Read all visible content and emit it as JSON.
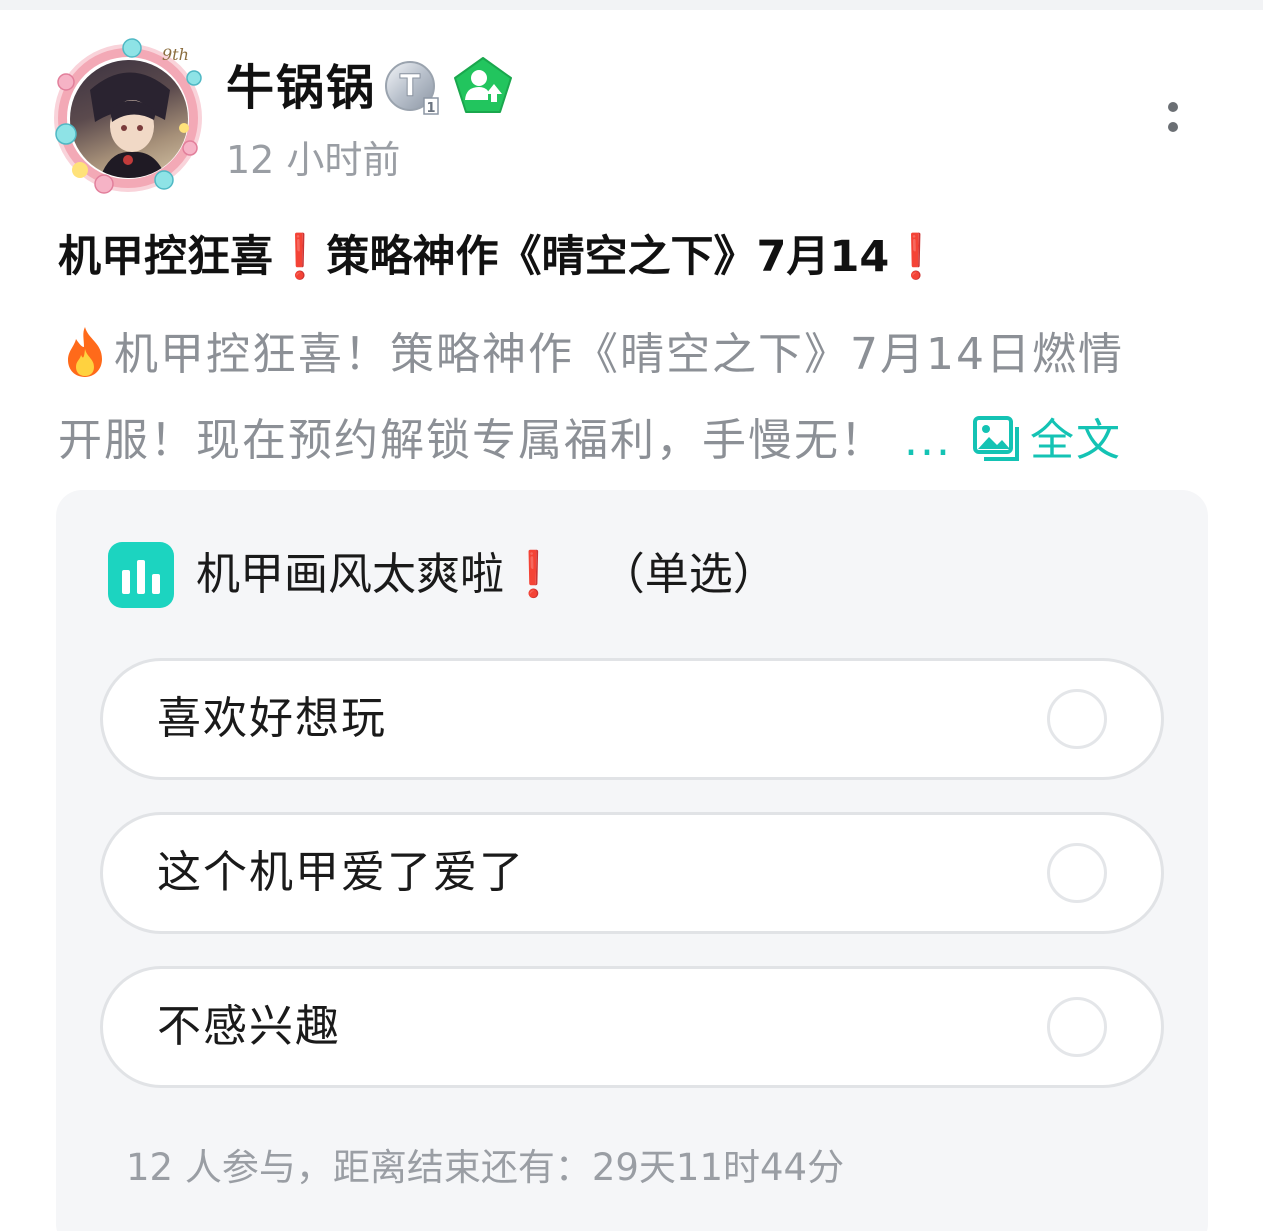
{
  "post": {
    "author": {
      "name": "牛锅锅",
      "avatar_icon": "avatar-frame-icon",
      "badges": [
        {
          "name": "t-level-badge-icon",
          "text": "T",
          "subscript": "1"
        },
        {
          "name": "user-upgrade-badge-icon"
        }
      ]
    },
    "time_ago": "12 小时前",
    "title_part1": "机甲控狂喜",
    "title_part2": "策略神作《晴空之下》7月14",
    "title_mark": "❗",
    "body_line1": "机甲控狂喜！策略神作《晴空之下》7月14日燃情",
    "body_line2": "开服！现在预约解锁专属福利，手慢无！",
    "ellipsis": "...",
    "full_text_label": "全文"
  },
  "poll": {
    "question": "机甲画风太爽啦",
    "question_mark": "❗",
    "type": "（单选）",
    "options": [
      {
        "label": "喜欢好想玩"
      },
      {
        "label": "这个机甲爱了爱了"
      },
      {
        "label": "不感兴趣"
      }
    ],
    "participants": "12 人参与，距离结束还有：29天11时44分"
  },
  "colors": {
    "accent": "#14c3b4",
    "poll_icon": "#1cd4c0",
    "badge_green": "#22c55e",
    "alert_red": "#e52e2e",
    "muted_text": "#9a9ea4",
    "card_bg": "#f5f6f8"
  }
}
